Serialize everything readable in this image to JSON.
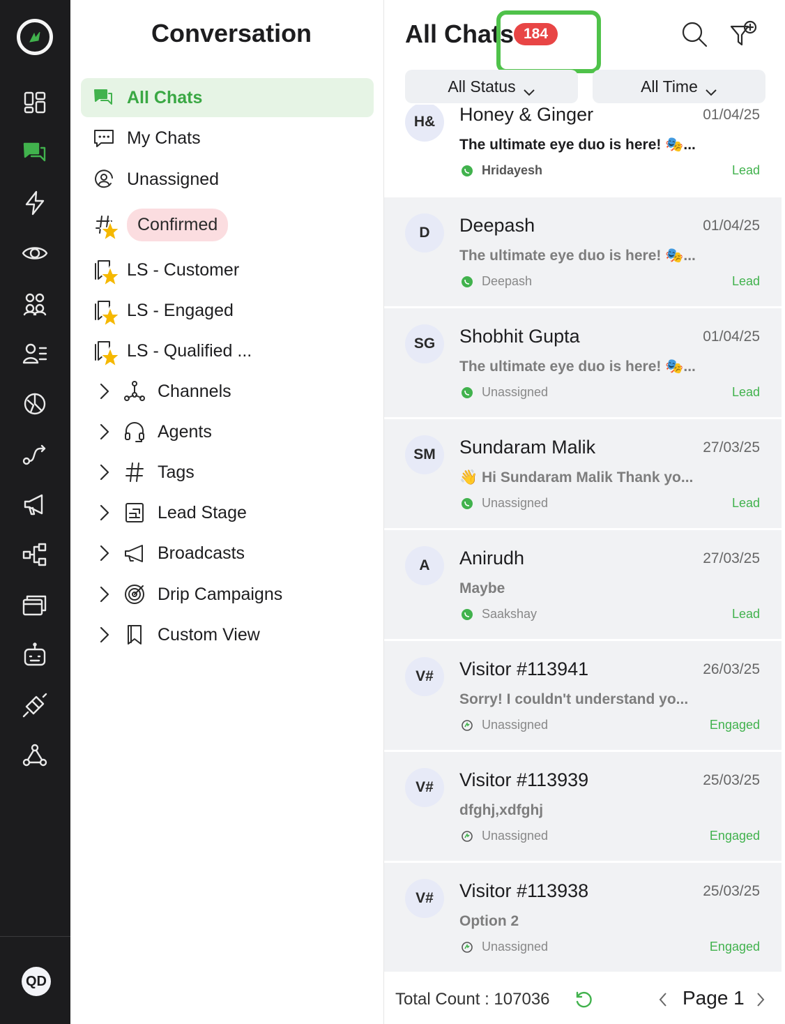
{
  "colors": {
    "accent": "#41b24d",
    "badge": "#e84545",
    "rail_bg": "#1c1c1e",
    "highlight": "#4fc24a"
  },
  "rail": {
    "icons": [
      "logo-icon",
      "dashboard-icon",
      "chats-icon",
      "bolt-icon",
      "eye-icon",
      "contacts-group-icon",
      "contacts-list-icon",
      "analytics-icon",
      "flows-icon",
      "broadcast-icon",
      "workflow-icon",
      "templates-icon",
      "bot-icon",
      "integrations-icon",
      "webhook-icon"
    ],
    "avatar": "QD"
  },
  "sidebar": {
    "title": "Conversation",
    "items": [
      {
        "label": "All Chats",
        "icon": "chats-icon",
        "active": true
      },
      {
        "label": "My Chats",
        "icon": "message-dots-icon"
      },
      {
        "label": "Unassigned",
        "icon": "at-user-icon"
      },
      {
        "label": "Confirmed",
        "icon": "hash-star-icon"
      },
      {
        "label": "LS - Customer",
        "icon": "bookmark-star-icon"
      },
      {
        "label": "LS - Engaged",
        "icon": "bookmark-star-icon"
      },
      {
        "label": "LS - Qualified ...",
        "icon": "bookmark-star-icon"
      }
    ],
    "groups": [
      {
        "label": "Channels",
        "icon": "channels-icon"
      },
      {
        "label": "Agents",
        "icon": "headset-icon"
      },
      {
        "label": "Tags",
        "icon": "hash-icon"
      },
      {
        "label": "Lead Stage",
        "icon": "lead-stage-icon"
      },
      {
        "label": "Broadcasts",
        "icon": "megaphone-icon"
      },
      {
        "label": "Drip Campaigns",
        "icon": "target-icon"
      },
      {
        "label": "Custom View",
        "icon": "bookmark-icon"
      }
    ]
  },
  "chats": {
    "title": "All Chats",
    "count": "184",
    "filters": {
      "status": "All Status",
      "time": "All Time"
    },
    "items": [
      {
        "initials": "H&",
        "name": "Honey & Ginger",
        "date": "01/04/25",
        "message": "The ultimate eye duo is here! 🎭...",
        "agent": "Hridayesh",
        "stage": "Lead",
        "channel": "whatsapp"
      },
      {
        "initials": "D",
        "name": "Deepash",
        "date": "01/04/25",
        "message": "The ultimate eye duo is here! 🎭...",
        "agent": "Deepash",
        "stage": "Lead",
        "channel": "whatsapp"
      },
      {
        "initials": "SG",
        "name": "Shobhit Gupta",
        "date": "01/04/25",
        "message": "The ultimate eye duo is here! 🎭...",
        "agent": "Unassigned",
        "stage": "Lead",
        "channel": "whatsapp"
      },
      {
        "initials": "SM",
        "name": "Sundaram Malik",
        "date": "27/03/25",
        "message": "👋 Hi Sundaram Malik Thank yo...",
        "agent": "Unassigned",
        "stage": "Lead",
        "channel": "whatsapp"
      },
      {
        "initials": "A",
        "name": "Anirudh",
        "date": "27/03/25",
        "message": "Maybe",
        "agent": "Saakshay",
        "stage": "Lead",
        "channel": "whatsapp"
      },
      {
        "initials": "V#",
        "name": "Visitor #113941",
        "date": "26/03/25",
        "message": "Sorry! I couldn't understand yo...",
        "agent": "Unassigned",
        "stage": "Engaged",
        "channel": "web"
      },
      {
        "initials": "V#",
        "name": "Visitor #113939",
        "date": "25/03/25",
        "message": "dfghj,xdfghj",
        "agent": "Unassigned",
        "stage": "Engaged",
        "channel": "web"
      },
      {
        "initials": "V#",
        "name": "Visitor #113938",
        "date": "25/03/25",
        "message": "Option 2",
        "agent": "Unassigned",
        "stage": "Engaged",
        "channel": "web"
      }
    ],
    "footer": {
      "total_label": "Total Count :",
      "total_value": "107036",
      "page_label": "Page 1"
    }
  }
}
